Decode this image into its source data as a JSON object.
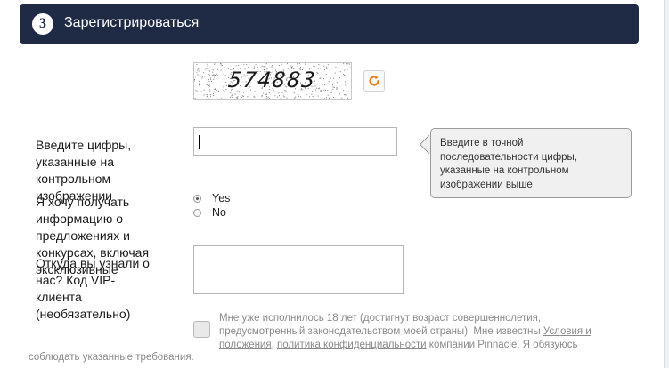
{
  "header": {
    "step": "3",
    "title": "Зарегистрироваться"
  },
  "captcha": {
    "code": "574883",
    "label": "Введите цифры, указанные на контрольном изображении",
    "input_value": "",
    "tooltip": "Введите в точной последовательности цифры, указанные на контрольном изображении выше"
  },
  "promo": {
    "label": "Я хочу получать информацию о предложениях и конкурсах, включая эксклюзивные",
    "options": [
      {
        "label": "Yes",
        "selected": true
      },
      {
        "label": "No",
        "selected": false
      }
    ]
  },
  "source": {
    "label": "Откуда вы узнали о нас? Код VIP-клиента (необязательно)",
    "value": ""
  },
  "terms": {
    "checked": false,
    "text_before": "Мне уже исполнилось 18 лет (достигнут возраст совершеннолетия, предусмотренный законодательством моей страны). Мне известны ",
    "link_terms": "Условия и положения",
    "sep": ", ",
    "link_privacy": "политика конфиденциальности",
    "text_after": " компании Pinnacle. Я обязуюсь",
    "continuation": "соблюдать указанные требования."
  },
  "colors": {
    "header_bg": "#1f2a44",
    "refresh_icon": "#f0801e",
    "tooltip_bg": "#f0f0f0"
  }
}
